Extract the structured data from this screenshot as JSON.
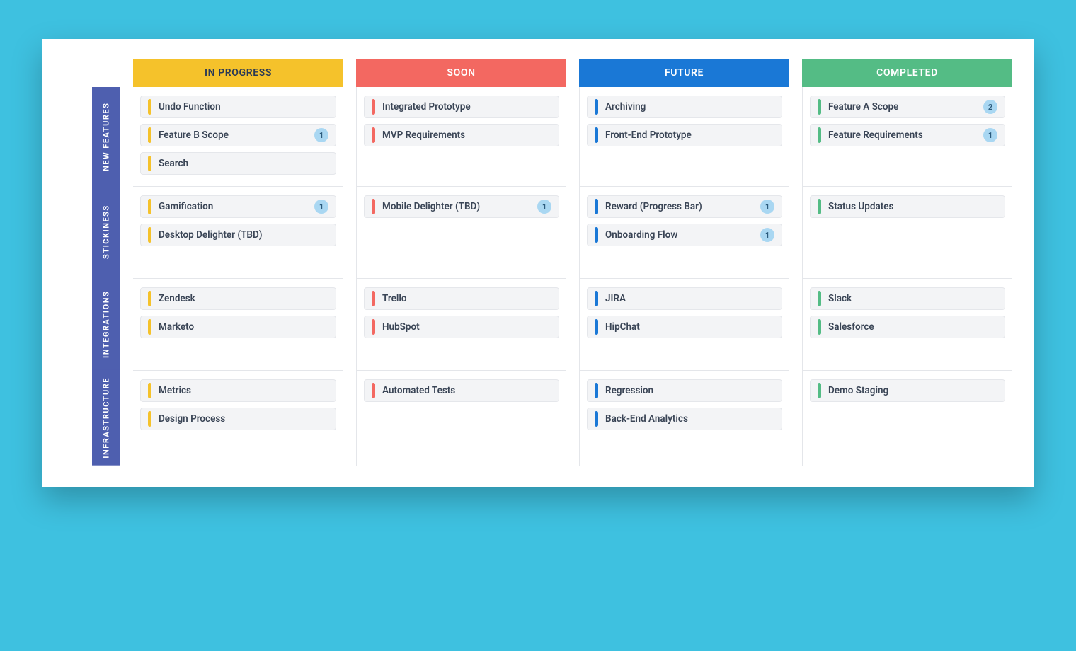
{
  "columns": [
    {
      "id": "in_progress",
      "label": "IN PROGRESS",
      "color": "yellow"
    },
    {
      "id": "soon",
      "label": "SOON",
      "color": "red"
    },
    {
      "id": "future",
      "label": "FUTURE",
      "color": "blue"
    },
    {
      "id": "completed",
      "label": "COMPLETED",
      "color": "green"
    }
  ],
  "rows": [
    {
      "id": "new_features",
      "label": "NEW FEATURES"
    },
    {
      "id": "stickiness",
      "label": "STICKINESS"
    },
    {
      "id": "integrations",
      "label": "INTEGRATIONS"
    },
    {
      "id": "infrastructure",
      "label": "INFRASTRUCTURE"
    }
  ],
  "cells": {
    "new_features": {
      "in_progress": [
        {
          "label": "Undo Function"
        },
        {
          "label": "Feature B Scope",
          "badge": "1"
        },
        {
          "label": "Search"
        }
      ],
      "soon": [
        {
          "label": "Integrated Prototype"
        },
        {
          "label": "MVP Requirements"
        }
      ],
      "future": [
        {
          "label": "Archiving"
        },
        {
          "label": "Front-End Prototype"
        }
      ],
      "completed": [
        {
          "label": "Feature A Scope",
          "badge": "2"
        },
        {
          "label": "Feature Requirements",
          "badge": "1"
        }
      ]
    },
    "stickiness": {
      "in_progress": [
        {
          "label": "Gamification",
          "badge": "1"
        },
        {
          "label": "Desktop Delighter (TBD)"
        }
      ],
      "soon": [
        {
          "label": "Mobile Delighter (TBD)",
          "badge": "1"
        }
      ],
      "future": [
        {
          "label": "Reward (Progress Bar)",
          "badge": "1"
        },
        {
          "label": "Onboarding Flow",
          "badge": "1"
        }
      ],
      "completed": [
        {
          "label": "Status Updates"
        }
      ]
    },
    "integrations": {
      "in_progress": [
        {
          "label": "Zendesk"
        },
        {
          "label": "Marketo"
        }
      ],
      "soon": [
        {
          "label": "Trello"
        },
        {
          "label": "HubSpot"
        }
      ],
      "future": [
        {
          "label": "JIRA"
        },
        {
          "label": "HipChat"
        }
      ],
      "completed": [
        {
          "label": "Slack"
        },
        {
          "label": "Salesforce"
        }
      ]
    },
    "infrastructure": {
      "in_progress": [
        {
          "label": "Metrics"
        },
        {
          "label": "Design Process"
        }
      ],
      "soon": [
        {
          "label": "Automated Tests"
        }
      ],
      "future": [
        {
          "label": "Regression"
        },
        {
          "label": "Back-End Analytics"
        }
      ],
      "completed": [
        {
          "label": "Demo Staging"
        }
      ]
    }
  }
}
